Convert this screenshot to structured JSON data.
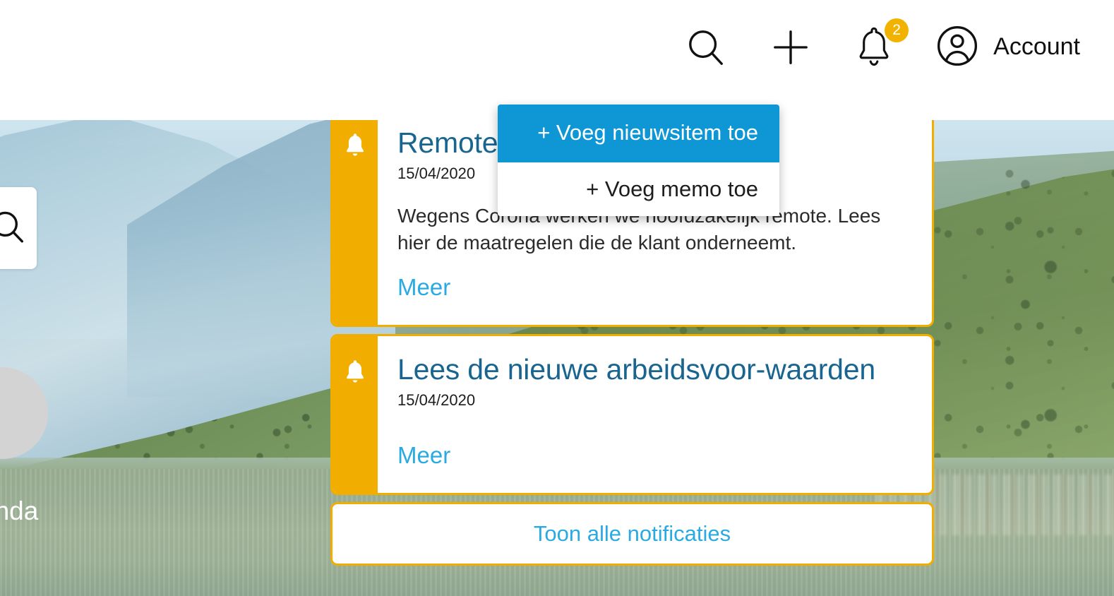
{
  "header": {
    "search_icon": "search-icon",
    "add_icon": "plus-icon",
    "notifications_icon": "bell-icon",
    "notifications_badge": "2",
    "account_icon": "user-circle-icon",
    "account_label": "Account"
  },
  "add_menu": {
    "items": [
      {
        "label": "+ Voeg nieuwsitem toe",
        "highlighted": true
      },
      {
        "label": "+ Voeg memo toe",
        "highlighted": false
      }
    ]
  },
  "side": {
    "search_icon": "search-icon",
    "avatar": "avatar-placeholder",
    "label": "anda"
  },
  "notifications": {
    "items": [
      {
        "icon": "bell-icon",
        "title": "Remote werken",
        "date": "15/04/2020",
        "text": "Wegens Corona werken we hoofdzakelijk remote. Lees hier de maatregelen die de klant onderneemt.",
        "more_label": "Meer"
      },
      {
        "icon": "bell-icon",
        "title": "Lees de nieuwe arbeidsvoor-waarden",
        "date": "15/04/2020",
        "text": "",
        "more_label": "Meer"
      }
    ],
    "footer_label": "Toon alle notificaties"
  },
  "colors": {
    "accent_orange": "#F2AE00",
    "badge_orange": "#F2B300",
    "link_blue": "#29ABE2",
    "title_blue": "#19658F",
    "menu_highlight_blue": "#0E97D4"
  }
}
